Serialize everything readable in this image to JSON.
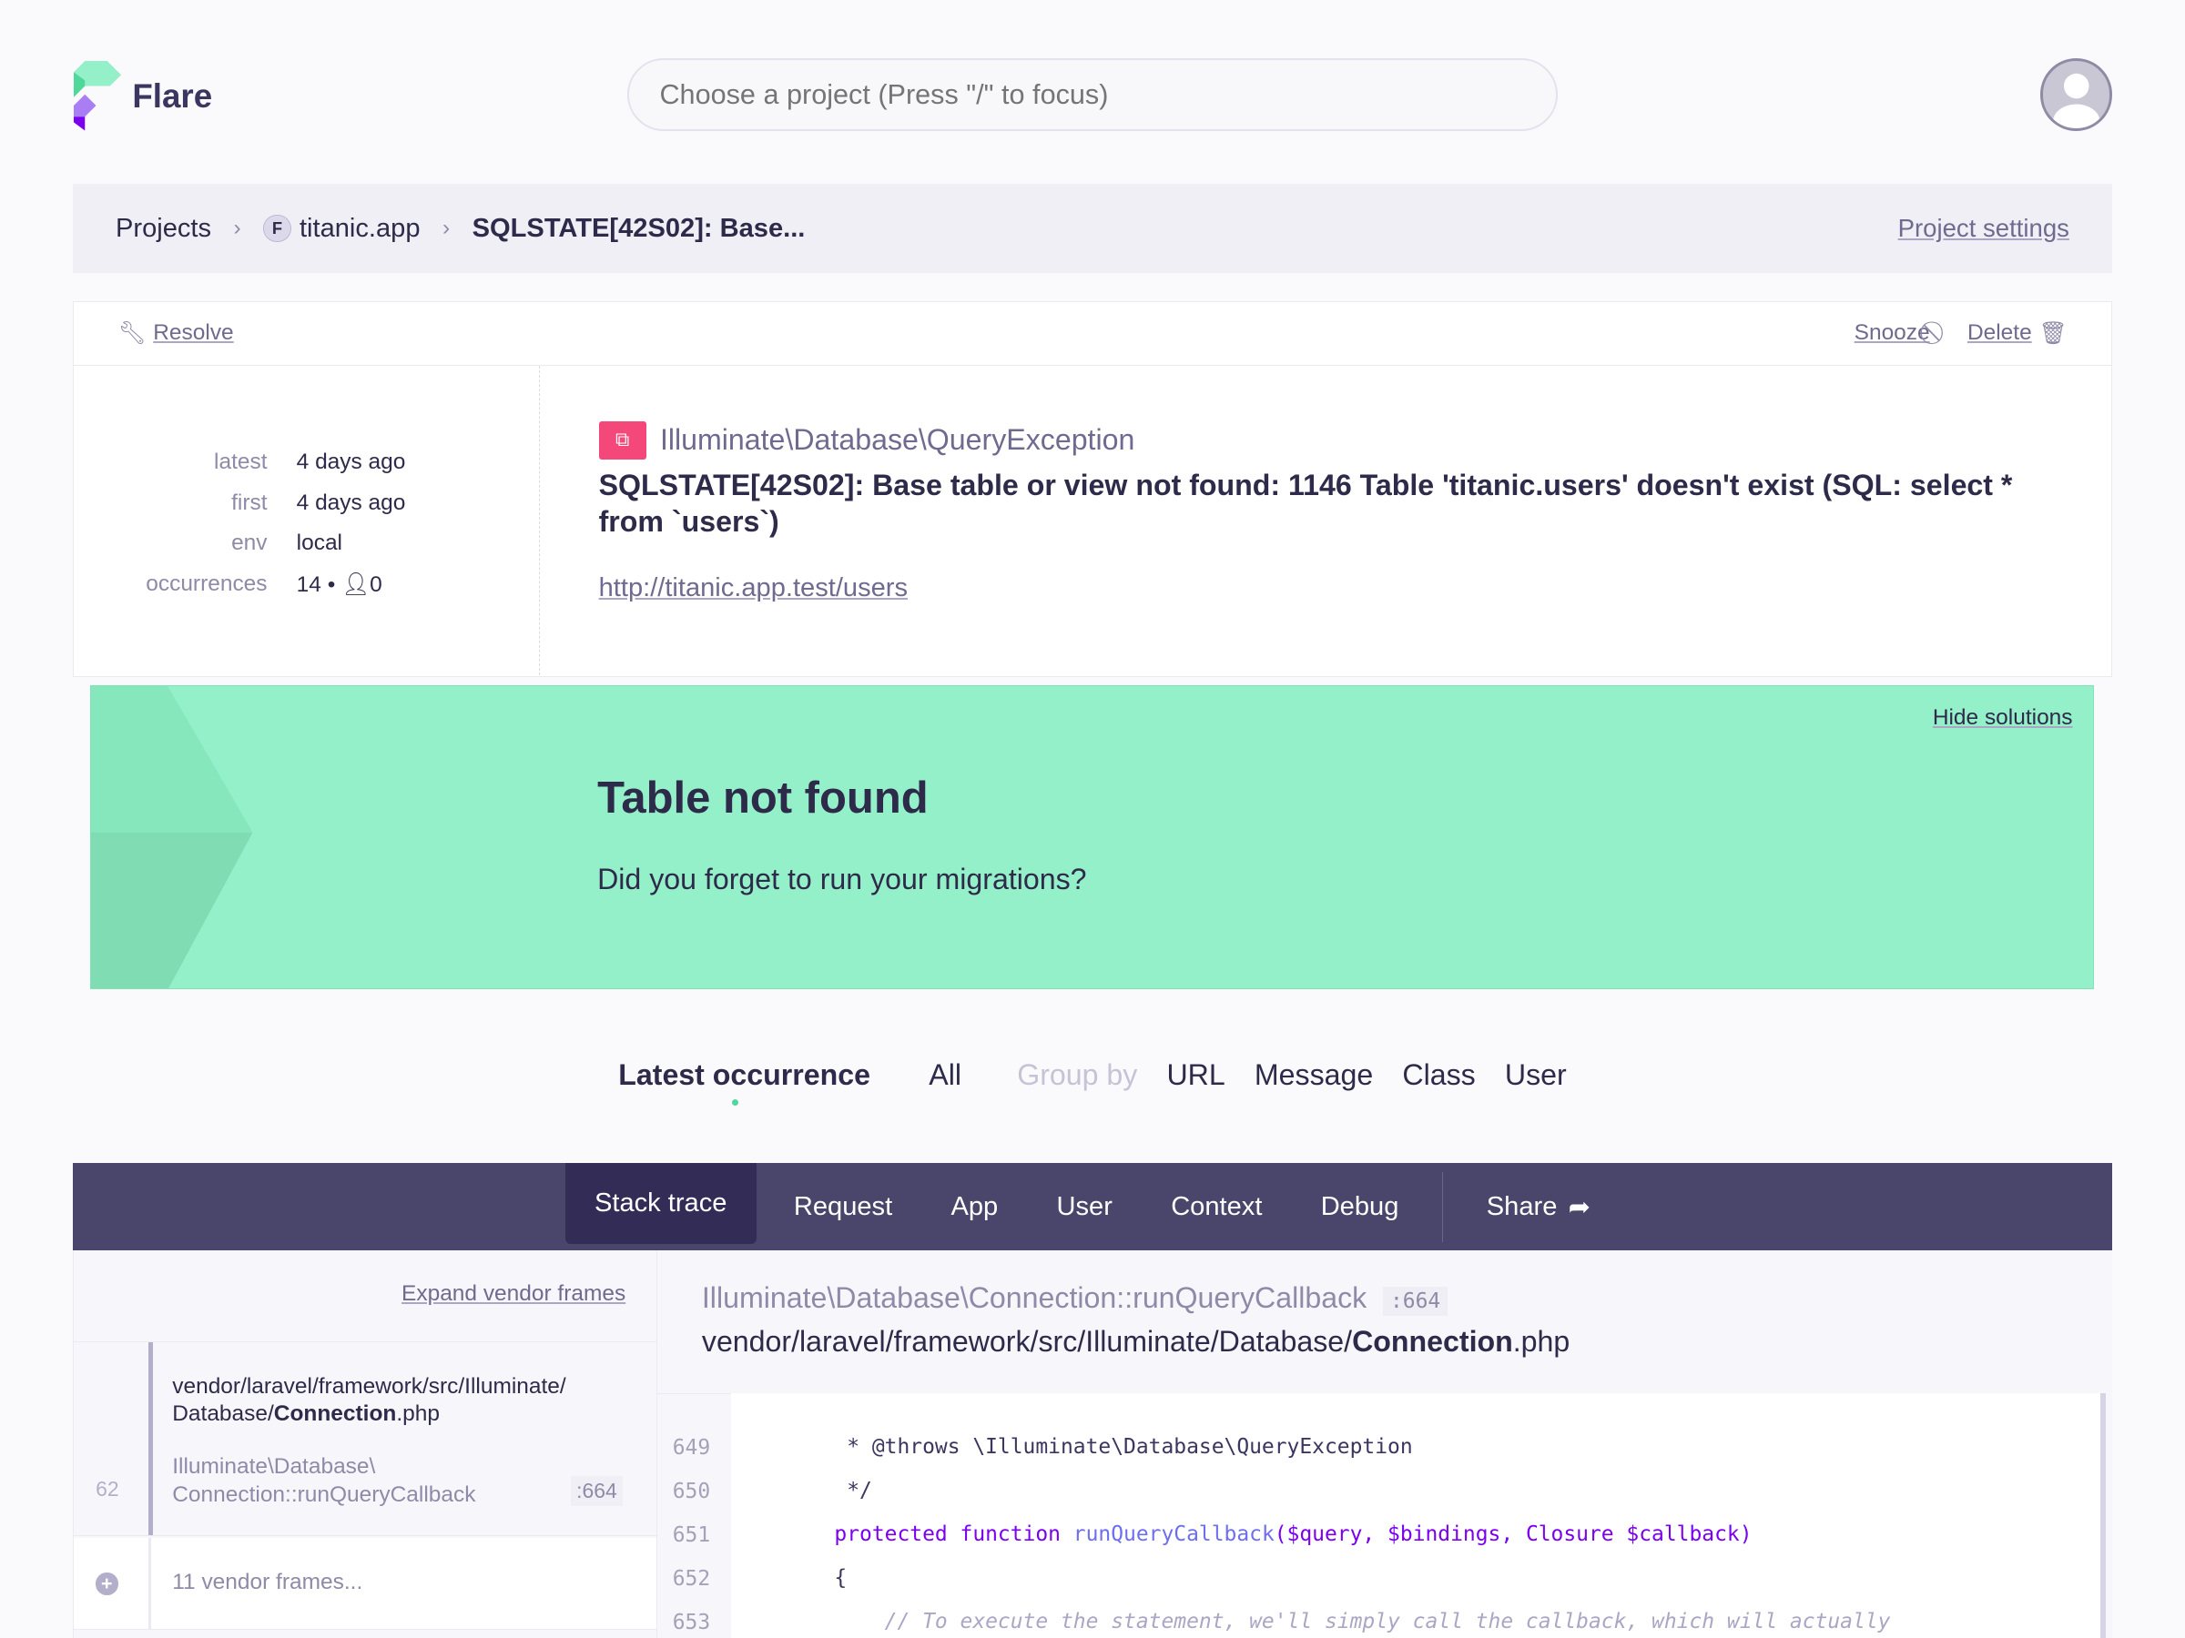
{
  "app": {
    "name": "Flare"
  },
  "search": {
    "placeholder": "Choose a project (Press \"/\" to focus)"
  },
  "breadcrumb": {
    "projects": "Projects",
    "project_badge": "F",
    "project": "titanic.app",
    "current": "SQLSTATE[42S02]: Base...",
    "settings": "Project settings"
  },
  "actions": {
    "resolve": "Resolve",
    "snooze": "Snooze",
    "delete": "Delete"
  },
  "meta": [
    {
      "k": "latest",
      "v": "4 days ago"
    },
    {
      "k": "first",
      "v": "4 days ago"
    },
    {
      "k": "env",
      "v": "local"
    }
  ],
  "occurrences": {
    "label": "occurrences",
    "count": "14",
    "bullet": "•",
    "users": "0"
  },
  "error": {
    "class": "Illuminate\\Database\\QueryException",
    "message": "SQLSTATE[42S02]: Base table or view not found: 1146 Table 'titanic.users' doesn't exist (SQL: select * from `users`)",
    "url": "http://titanic.app.test/users",
    "brand_color": "#f4477a"
  },
  "solution": {
    "hide": "Hide solutions",
    "title": "Table not found",
    "description": "Did you forget to run your migrations?",
    "bg_color": "#94f0c8"
  },
  "occurrence_tabs": {
    "latest": "Latest occurrence",
    "all": "All",
    "group_by": "Group by",
    "groups": [
      "URL",
      "Message",
      "Class",
      "User"
    ]
  },
  "nav": {
    "tabs": [
      "Stack trace",
      "Request",
      "App",
      "User",
      "Context",
      "Debug"
    ],
    "active": "Stack trace",
    "share": "Share"
  },
  "frames": {
    "expand": "Expand vendor frames",
    "frame": {
      "number": "62",
      "path_prefix": "vendor/laravel/framework/src/Illuminate/ Database/",
      "path_file": "Connection",
      "path_ext": ".php",
      "class": "Illuminate\\Database\\ Connection",
      "method": "::runQueryCallback",
      "line": ":664"
    },
    "vendor": "11 vendor frames..."
  },
  "detail": {
    "class": "Illuminate\\Database\\Connection",
    "method": "::runQueryCallback",
    "line": ":664",
    "path_prefix": "vendor/laravel/framework/src/Illuminate/Database/",
    "path_file": "Connection",
    "path_ext": ".php"
  },
  "code": {
    "lines": [
      "649",
      "650",
      "651",
      "652",
      "653"
    ],
    "l649": "     * @throws \\Illuminate\\Database\\QueryException",
    "l650": "     */",
    "l651a": "    protected function ",
    "l651b": "runQueryCallback",
    "l651c": "($query, $bindings, Closure $callback)",
    "l652": "    {",
    "l653": "        // To execute the statement, we'll simply call the callback, which will actually"
  }
}
